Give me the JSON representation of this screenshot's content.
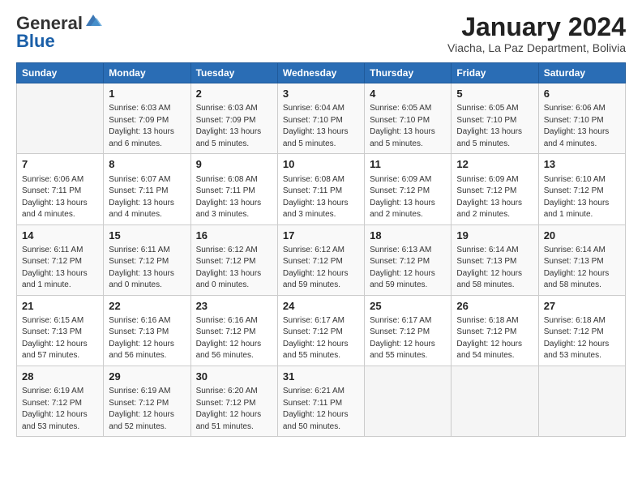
{
  "logo": {
    "general": "General",
    "blue": "Blue"
  },
  "title": "January 2024",
  "location": "Viacha, La Paz Department, Bolivia",
  "days_of_week": [
    "Sunday",
    "Monday",
    "Tuesday",
    "Wednesday",
    "Thursday",
    "Friday",
    "Saturday"
  ],
  "weeks": [
    [
      {
        "num": "",
        "info": ""
      },
      {
        "num": "1",
        "info": "Sunrise: 6:03 AM\nSunset: 7:09 PM\nDaylight: 13 hours\nand 6 minutes."
      },
      {
        "num": "2",
        "info": "Sunrise: 6:03 AM\nSunset: 7:09 PM\nDaylight: 13 hours\nand 5 minutes."
      },
      {
        "num": "3",
        "info": "Sunrise: 6:04 AM\nSunset: 7:10 PM\nDaylight: 13 hours\nand 5 minutes."
      },
      {
        "num": "4",
        "info": "Sunrise: 6:05 AM\nSunset: 7:10 PM\nDaylight: 13 hours\nand 5 minutes."
      },
      {
        "num": "5",
        "info": "Sunrise: 6:05 AM\nSunset: 7:10 PM\nDaylight: 13 hours\nand 5 minutes."
      },
      {
        "num": "6",
        "info": "Sunrise: 6:06 AM\nSunset: 7:10 PM\nDaylight: 13 hours\nand 4 minutes."
      }
    ],
    [
      {
        "num": "7",
        "info": "Sunrise: 6:06 AM\nSunset: 7:11 PM\nDaylight: 13 hours\nand 4 minutes."
      },
      {
        "num": "8",
        "info": "Sunrise: 6:07 AM\nSunset: 7:11 PM\nDaylight: 13 hours\nand 4 minutes."
      },
      {
        "num": "9",
        "info": "Sunrise: 6:08 AM\nSunset: 7:11 PM\nDaylight: 13 hours\nand 3 minutes."
      },
      {
        "num": "10",
        "info": "Sunrise: 6:08 AM\nSunset: 7:11 PM\nDaylight: 13 hours\nand 3 minutes."
      },
      {
        "num": "11",
        "info": "Sunrise: 6:09 AM\nSunset: 7:12 PM\nDaylight: 13 hours\nand 2 minutes."
      },
      {
        "num": "12",
        "info": "Sunrise: 6:09 AM\nSunset: 7:12 PM\nDaylight: 13 hours\nand 2 minutes."
      },
      {
        "num": "13",
        "info": "Sunrise: 6:10 AM\nSunset: 7:12 PM\nDaylight: 13 hours\nand 1 minute."
      }
    ],
    [
      {
        "num": "14",
        "info": "Sunrise: 6:11 AM\nSunset: 7:12 PM\nDaylight: 13 hours\nand 1 minute."
      },
      {
        "num": "15",
        "info": "Sunrise: 6:11 AM\nSunset: 7:12 PM\nDaylight: 13 hours\nand 0 minutes."
      },
      {
        "num": "16",
        "info": "Sunrise: 6:12 AM\nSunset: 7:12 PM\nDaylight: 13 hours\nand 0 minutes."
      },
      {
        "num": "17",
        "info": "Sunrise: 6:12 AM\nSunset: 7:12 PM\nDaylight: 12 hours\nand 59 minutes."
      },
      {
        "num": "18",
        "info": "Sunrise: 6:13 AM\nSunset: 7:12 PM\nDaylight: 12 hours\nand 59 minutes."
      },
      {
        "num": "19",
        "info": "Sunrise: 6:14 AM\nSunset: 7:13 PM\nDaylight: 12 hours\nand 58 minutes."
      },
      {
        "num": "20",
        "info": "Sunrise: 6:14 AM\nSunset: 7:13 PM\nDaylight: 12 hours\nand 58 minutes."
      }
    ],
    [
      {
        "num": "21",
        "info": "Sunrise: 6:15 AM\nSunset: 7:13 PM\nDaylight: 12 hours\nand 57 minutes."
      },
      {
        "num": "22",
        "info": "Sunrise: 6:16 AM\nSunset: 7:13 PM\nDaylight: 12 hours\nand 56 minutes."
      },
      {
        "num": "23",
        "info": "Sunrise: 6:16 AM\nSunset: 7:12 PM\nDaylight: 12 hours\nand 56 minutes."
      },
      {
        "num": "24",
        "info": "Sunrise: 6:17 AM\nSunset: 7:12 PM\nDaylight: 12 hours\nand 55 minutes."
      },
      {
        "num": "25",
        "info": "Sunrise: 6:17 AM\nSunset: 7:12 PM\nDaylight: 12 hours\nand 55 minutes."
      },
      {
        "num": "26",
        "info": "Sunrise: 6:18 AM\nSunset: 7:12 PM\nDaylight: 12 hours\nand 54 minutes."
      },
      {
        "num": "27",
        "info": "Sunrise: 6:18 AM\nSunset: 7:12 PM\nDaylight: 12 hours\nand 53 minutes."
      }
    ],
    [
      {
        "num": "28",
        "info": "Sunrise: 6:19 AM\nSunset: 7:12 PM\nDaylight: 12 hours\nand 53 minutes."
      },
      {
        "num": "29",
        "info": "Sunrise: 6:19 AM\nSunset: 7:12 PM\nDaylight: 12 hours\nand 52 minutes."
      },
      {
        "num": "30",
        "info": "Sunrise: 6:20 AM\nSunset: 7:12 PM\nDaylight: 12 hours\nand 51 minutes."
      },
      {
        "num": "31",
        "info": "Sunrise: 6:21 AM\nSunset: 7:11 PM\nDaylight: 12 hours\nand 50 minutes."
      },
      {
        "num": "",
        "info": ""
      },
      {
        "num": "",
        "info": ""
      },
      {
        "num": "",
        "info": ""
      }
    ]
  ]
}
